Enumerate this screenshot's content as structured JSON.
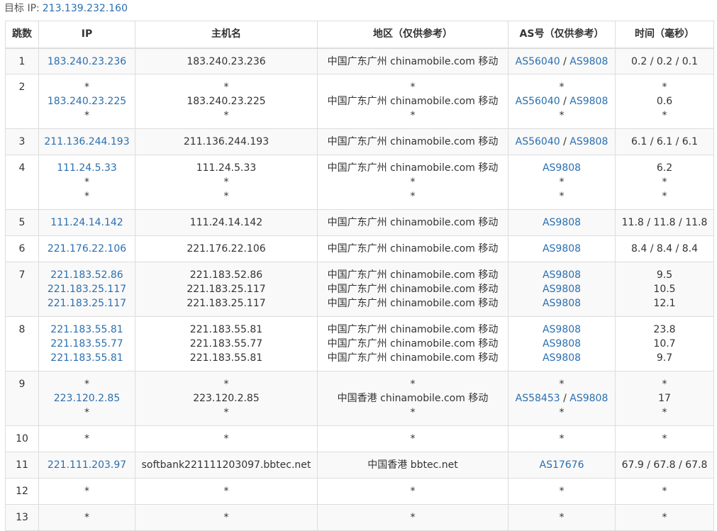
{
  "header": {
    "label": "目标 IP:",
    "ip": "213.139.232.160"
  },
  "columns": [
    "跳数",
    "IP",
    "主机名",
    "地区（仅供参考）",
    "AS号（仅供参考）",
    "时间（毫秒）"
  ],
  "rows": [
    {
      "hop": "1",
      "ips": [
        "183.240.23.236"
      ],
      "hosts": [
        "183.240.23.236"
      ],
      "regions": [
        "中国广东广州 chinamobile.com 移动"
      ],
      "asns": [
        [
          "AS56040",
          "AS9808"
        ]
      ],
      "times": [
        "0.2 / 0.2 / 0.1"
      ]
    },
    {
      "hop": "2",
      "ips": [
        "*",
        "183.240.23.225",
        "*"
      ],
      "hosts": [
        "*",
        "183.240.23.225",
        "*"
      ],
      "regions": [
        "*",
        "中国广东广州 chinamobile.com 移动",
        "*"
      ],
      "asns": [
        [
          "*"
        ],
        [
          "AS56040",
          "AS9808"
        ],
        [
          "*"
        ]
      ],
      "times": [
        "*",
        "0.6",
        "*"
      ]
    },
    {
      "hop": "3",
      "ips": [
        "211.136.244.193"
      ],
      "hosts": [
        "211.136.244.193"
      ],
      "regions": [
        "中国广东广州 chinamobile.com 移动"
      ],
      "asns": [
        [
          "AS56040",
          "AS9808"
        ]
      ],
      "times": [
        "6.1 / 6.1 / 6.1"
      ]
    },
    {
      "hop": "4",
      "ips": [
        "111.24.5.33",
        "*",
        "*"
      ],
      "hosts": [
        "111.24.5.33",
        "*",
        "*"
      ],
      "regions": [
        "中国广东广州 chinamobile.com 移动",
        "*",
        "*"
      ],
      "asns": [
        [
          "AS9808"
        ],
        [
          "*"
        ],
        [
          "*"
        ]
      ],
      "times": [
        "6.2",
        "*",
        "*"
      ]
    },
    {
      "hop": "5",
      "ips": [
        "111.24.14.142"
      ],
      "hosts": [
        "111.24.14.142"
      ],
      "regions": [
        "中国广东广州 chinamobile.com 移动"
      ],
      "asns": [
        [
          "AS9808"
        ]
      ],
      "times": [
        "11.8 / 11.8 / 11.8"
      ]
    },
    {
      "hop": "6",
      "ips": [
        "221.176.22.106"
      ],
      "hosts": [
        "221.176.22.106"
      ],
      "regions": [
        "中国广东广州 chinamobile.com 移动"
      ],
      "asns": [
        [
          "AS9808"
        ]
      ],
      "times": [
        "8.4 / 8.4 / 8.4"
      ]
    },
    {
      "hop": "7",
      "ips": [
        "221.183.52.86",
        "221.183.25.117",
        "221.183.25.117"
      ],
      "hosts": [
        "221.183.52.86",
        "221.183.25.117",
        "221.183.25.117"
      ],
      "regions": [
        "中国广东广州 chinamobile.com 移动",
        "中国广东广州 chinamobile.com 移动",
        "中国广东广州 chinamobile.com 移动"
      ],
      "asns": [
        [
          "AS9808"
        ],
        [
          "AS9808"
        ],
        [
          "AS9808"
        ]
      ],
      "times": [
        "9.5",
        "10.5",
        "12.1"
      ]
    },
    {
      "hop": "8",
      "ips": [
        "221.183.55.81",
        "221.183.55.77",
        "221.183.55.81"
      ],
      "hosts": [
        "221.183.55.81",
        "221.183.55.77",
        "221.183.55.81"
      ],
      "regions": [
        "中国广东广州 chinamobile.com 移动",
        "中国广东广州 chinamobile.com 移动",
        "中国广东广州 chinamobile.com 移动"
      ],
      "asns": [
        [
          "AS9808"
        ],
        [
          "AS9808"
        ],
        [
          "AS9808"
        ]
      ],
      "times": [
        "23.8",
        "10.7",
        "9.7"
      ]
    },
    {
      "hop": "9",
      "ips": [
        "*",
        "223.120.2.85",
        "*"
      ],
      "hosts": [
        "*",
        "223.120.2.85",
        "*"
      ],
      "regions": [
        "*",
        "中国香港 chinamobile.com 移动",
        "*"
      ],
      "asns": [
        [
          "*"
        ],
        [
          "AS58453",
          "AS9808"
        ],
        [
          "*"
        ]
      ],
      "times": [
        "*",
        "17",
        "*"
      ]
    },
    {
      "hop": "10",
      "ips": [
        "*"
      ],
      "hosts": [
        "*"
      ],
      "regions": [
        "*"
      ],
      "asns": [
        [
          "*"
        ]
      ],
      "times": [
        "*"
      ]
    },
    {
      "hop": "11",
      "ips": [
        "221.111.203.97"
      ],
      "hosts": [
        "softbank221111203097.bbtec.net"
      ],
      "regions": [
        "中国香港 bbtec.net"
      ],
      "asns": [
        [
          "AS17676"
        ]
      ],
      "times": [
        "67.9 / 67.8 / 67.8"
      ]
    },
    {
      "hop": "12",
      "ips": [
        "*"
      ],
      "hosts": [
        "*"
      ],
      "regions": [
        "*"
      ],
      "asns": [
        [
          "*"
        ]
      ],
      "times": [
        "*"
      ]
    },
    {
      "hop": "13",
      "ips": [
        "*"
      ],
      "hosts": [
        "*"
      ],
      "regions": [
        "*"
      ],
      "asns": [
        [
          "*"
        ]
      ],
      "times": [
        "*"
      ]
    }
  ]
}
